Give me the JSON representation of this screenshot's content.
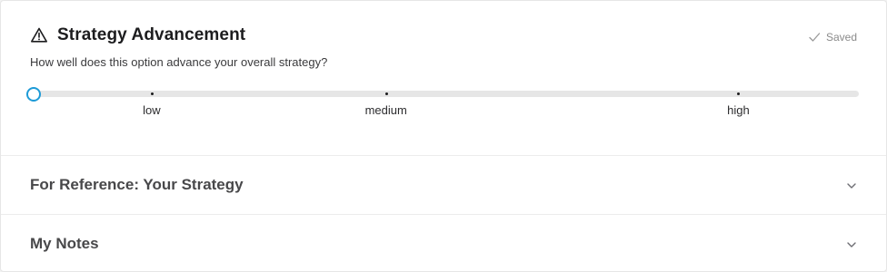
{
  "strategy": {
    "title": "Strategy Advancement",
    "question": "How well does this option advance your overall strategy?",
    "saved_label": "Saved",
    "slider": {
      "value_fraction": 0.0,
      "ticks": [
        {
          "label": "low",
          "fraction": 0.143
        },
        {
          "label": "medium",
          "fraction": 0.427
        },
        {
          "label": "high",
          "fraction": 0.854
        }
      ]
    }
  },
  "sections": [
    {
      "title": "For Reference: Your Strategy"
    },
    {
      "title": "My Notes"
    }
  ],
  "colors": {
    "accent": "#1e9bd7",
    "track": "#e6e6e6",
    "text": "#1d1d1f"
  },
  "icons": {
    "title_icon": "warning-triangle-icon",
    "saved_icon": "check-icon",
    "section_icon": "chevron-down-icon"
  }
}
